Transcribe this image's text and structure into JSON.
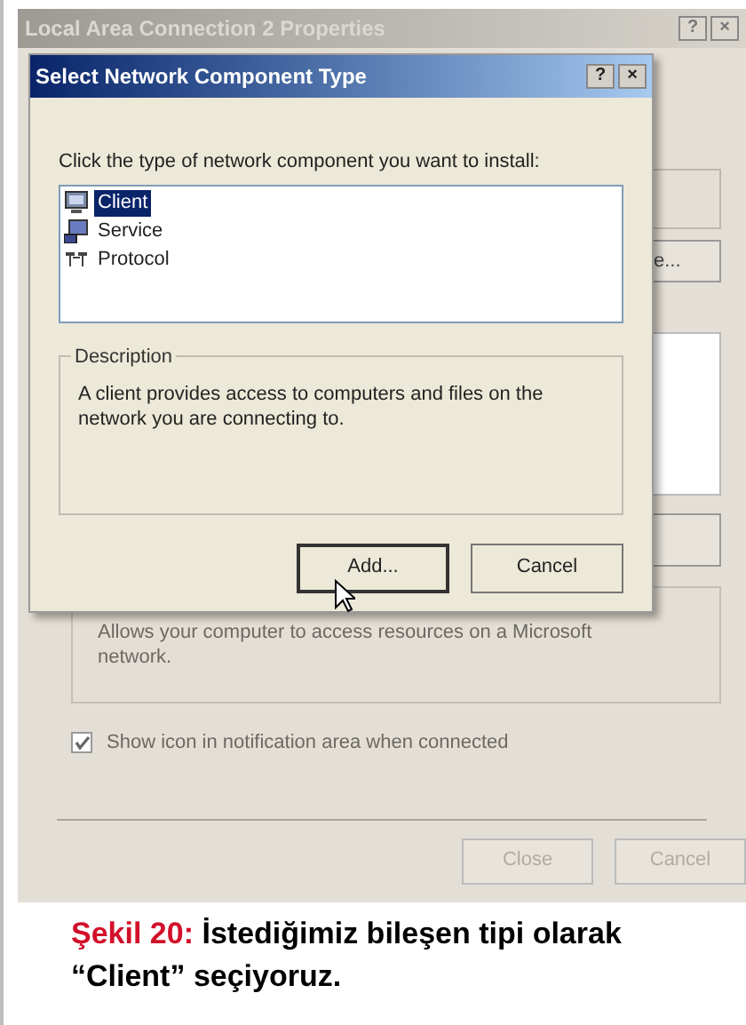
{
  "back_window": {
    "title": "Local Area Connection 2 Properties",
    "title_buttons": [
      "?",
      "×"
    ],
    "partial_button": "e...",
    "description": "Allows your computer to access resources on a Microsoft network.",
    "checkbox": {
      "label": "Show icon in notification area when connected",
      "checked": true
    },
    "buttons": [
      "Close",
      "Cancel"
    ]
  },
  "dialog": {
    "title": "Select Network Component Type",
    "title_buttons": [
      "?",
      "×"
    ],
    "prompt": "Click the type of network component you want to install:",
    "items": [
      {
        "label": "Client",
        "kind": "client",
        "selected": true
      },
      {
        "label": "Service",
        "kind": "service",
        "selected": false
      },
      {
        "label": "Protocol",
        "kind": "protocol",
        "selected": false
      }
    ],
    "description_label": "Description",
    "description": "A client provides access to computers and files on the network you are connecting to.",
    "buttons": [
      {
        "label": "Add...",
        "default": true
      },
      {
        "label": "Cancel",
        "default": false
      }
    ]
  },
  "caption": {
    "label": "Şekil 20:",
    "text": "İstediğimiz bileşen tipi olarak “Client” seçiyoruz."
  }
}
